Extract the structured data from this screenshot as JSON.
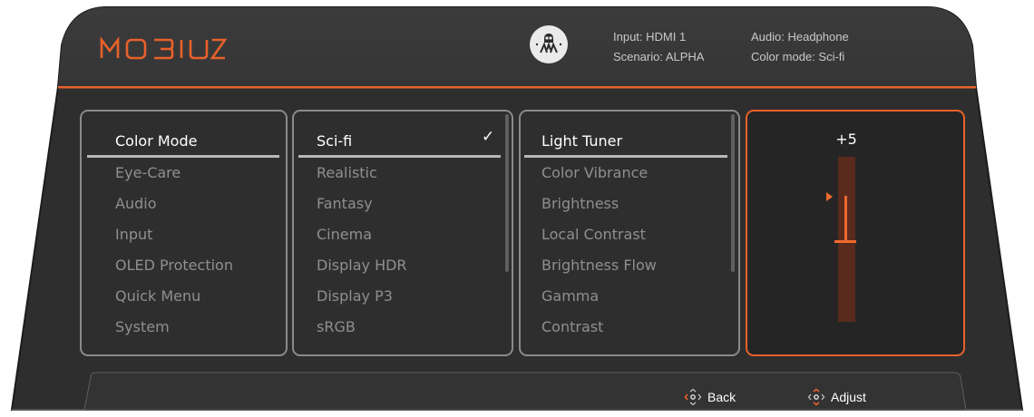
{
  "brand": {
    "logo_text": "MOBIUZ",
    "accent_color": "#e8612a"
  },
  "header": {
    "scenario_icon": "scenario-alien-icon",
    "input": "Input: HDMI 1",
    "scenario": "Scenario: ALPHA",
    "audio": "Audio: Headphone",
    "color_mode": "Color mode: Sci-fi"
  },
  "menu": {
    "main": [
      "Color Mode",
      "Eye-Care",
      "Audio",
      "Input",
      "OLED Protection",
      "Quick Menu",
      "System"
    ],
    "main_selected": "Color Mode",
    "color_modes": [
      "Sci-fi",
      "Realistic",
      "Fantasy",
      "Cinema",
      "Display HDR",
      "Display P3",
      "sRGB"
    ],
    "color_mode_selected": "Sci-fi",
    "settings": [
      "Light Tuner",
      "Color Vibrance",
      "Brightness",
      "Local Contrast",
      "Brightness Flow",
      "Gamma",
      "Contrast"
    ],
    "setting_selected": "Light Tuner"
  },
  "adjust": {
    "value_label": "+5",
    "value": 5,
    "range": [
      -10,
      10
    ]
  },
  "footer": {
    "back_label": "Back",
    "adjust_label": "Adjust",
    "back_icon": "joystick-back-icon",
    "adjust_icon": "joystick-adjust-icon"
  }
}
